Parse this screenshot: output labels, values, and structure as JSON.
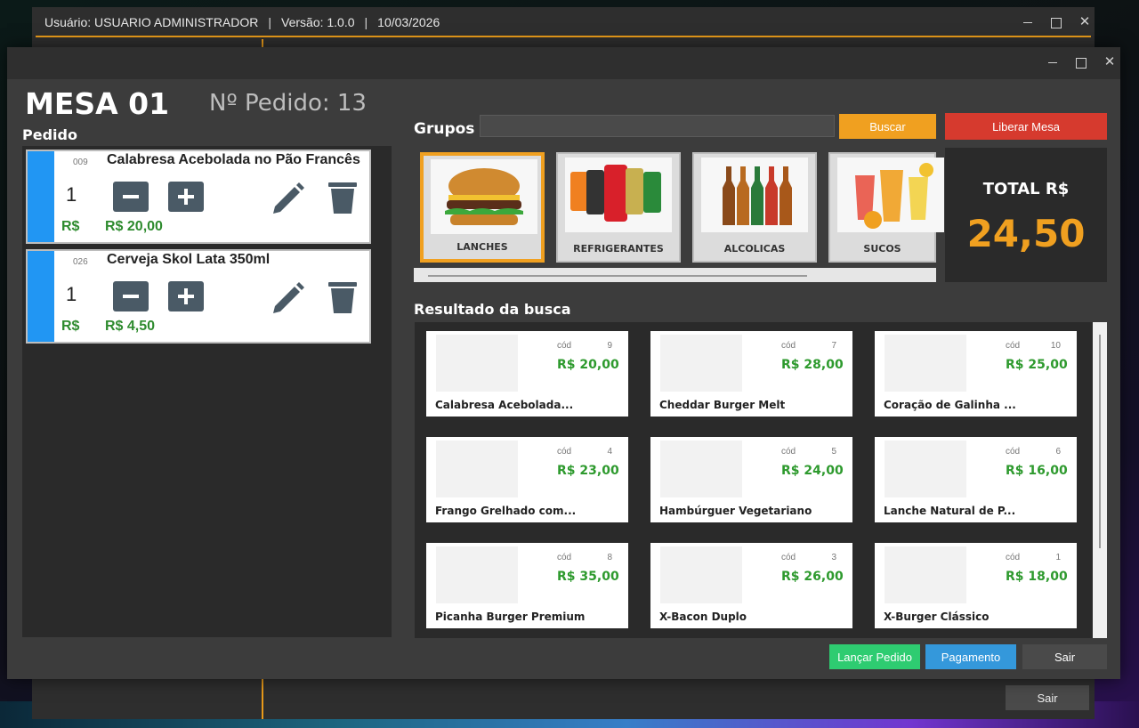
{
  "back_window": {
    "user_label": "Usuário: USUARIO ADMINISTRADOR",
    "sep1": "|",
    "version_label": "Versão: 1.0.0",
    "sep2": "|",
    "date": "10/03/2026",
    "sair_label": "Sair"
  },
  "header": {
    "mesa": "MESA 01",
    "pedido_numero": "Nº Pedido: 13",
    "pedido_label": "Pedido"
  },
  "order": {
    "items": [
      {
        "code": "009",
        "name": "Calabresa Acebolada no Pão Francês",
        "qty": "1",
        "currency": "R$",
        "price": "R$ 20,00"
      },
      {
        "code": "026",
        "name": "Cerveja Skol Lata 350ml",
        "qty": "1",
        "currency": "R$",
        "price": "R$ 4,50"
      }
    ]
  },
  "grupos": {
    "label": "Grupos",
    "search_value": "",
    "buscar_label": "Buscar",
    "liberar_label": "Liberar Mesa",
    "items": [
      {
        "label": "LANCHES",
        "icon": "burger-icon",
        "active": true
      },
      {
        "label": "REFRIGERANTES",
        "icon": "soda-cans-icon",
        "active": false
      },
      {
        "label": "ALCOLICAS",
        "icon": "beer-bottles-icon",
        "active": false
      },
      {
        "label": "SUCOS",
        "icon": "juice-glasses-icon",
        "active": false
      }
    ]
  },
  "total": {
    "label": "TOTAL R$",
    "value": "24,50"
  },
  "results": {
    "label": "Resultado da busca",
    "cod_label": "cód",
    "items": [
      {
        "cod": "9",
        "price": "R$ 20,00",
        "name": "Calabresa Acebolada..."
      },
      {
        "cod": "7",
        "price": "R$ 28,00",
        "name": "Cheddar Burger Melt"
      },
      {
        "cod": "10",
        "price": "R$ 25,00",
        "name": "Coração de Galinha ..."
      },
      {
        "cod": "4",
        "price": "R$ 23,00",
        "name": "Frango Grelhado com..."
      },
      {
        "cod": "5",
        "price": "R$ 24,00",
        "name": "Hambúrguer Vegetariano"
      },
      {
        "cod": "6",
        "price": "R$ 16,00",
        "name": "Lanche Natural de P..."
      },
      {
        "cod": "8",
        "price": "R$ 35,00",
        "name": "Picanha Burger Premium"
      },
      {
        "cod": "3",
        "price": "R$ 26,00",
        "name": "X-Bacon Duplo"
      },
      {
        "cod": "1",
        "price": "R$ 18,00",
        "name": "X-Burger Clássico"
      }
    ]
  },
  "actions": {
    "lancar_label": "Lançar Pedido",
    "pagamento_label": "Pagamento",
    "sair_label": "Sair"
  },
  "colors": {
    "accent_orange": "#f0a020",
    "danger_red": "#d63a2e",
    "success_green": "#2ecc71",
    "info_blue": "#3498db",
    "price_green": "#2e9a2e",
    "order_bar_blue": "#2196f3"
  }
}
